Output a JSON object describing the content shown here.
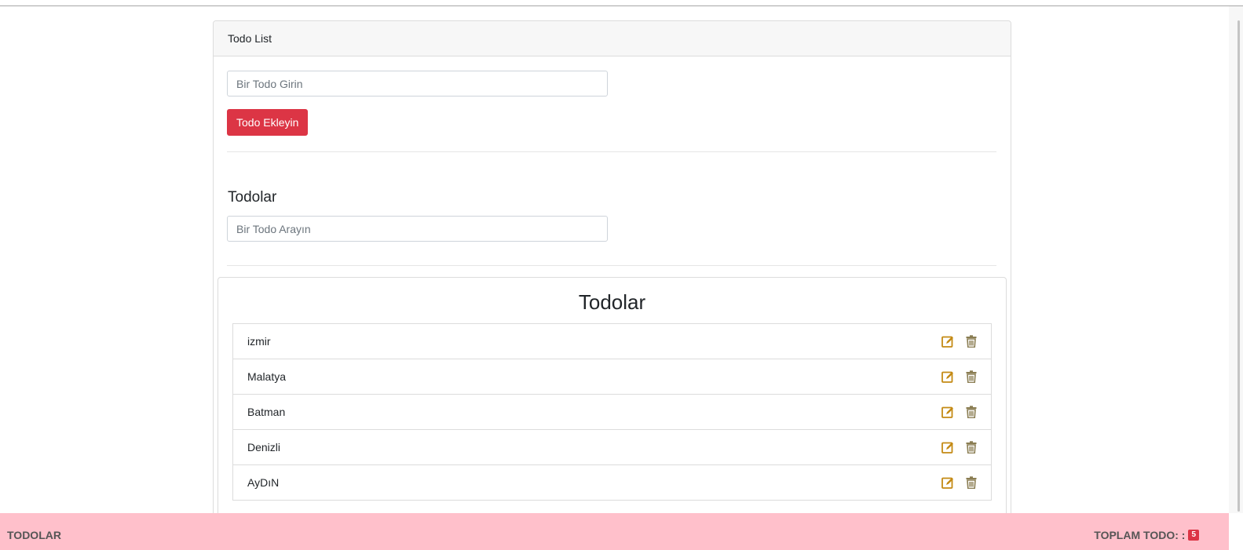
{
  "card": {
    "header_title": "Todo List"
  },
  "add_form": {
    "placeholder": "Bir Todo Girin",
    "button_label": "Todo Ekleyin"
  },
  "search": {
    "title": "Todolar",
    "placeholder": "Bir Todo Arayın"
  },
  "list": {
    "title": "Todolar",
    "items": [
      {
        "label": "izmir"
      },
      {
        "label": "Malatya"
      },
      {
        "label": "Batman"
      },
      {
        "label": "Denizli"
      },
      {
        "label": "AyDıN"
      }
    ]
  },
  "footer": {
    "left_label": "TODOLAR",
    "right_label": "TOPLAM TODO: :",
    "count": "5"
  },
  "icons": {
    "edit": "edit-icon",
    "delete": "trash-icon"
  },
  "colors": {
    "danger": "#dc3545",
    "footer_bg": "#ffc0cb",
    "edit_icon": "#c48a14",
    "delete_icon": "#8a7d52"
  }
}
